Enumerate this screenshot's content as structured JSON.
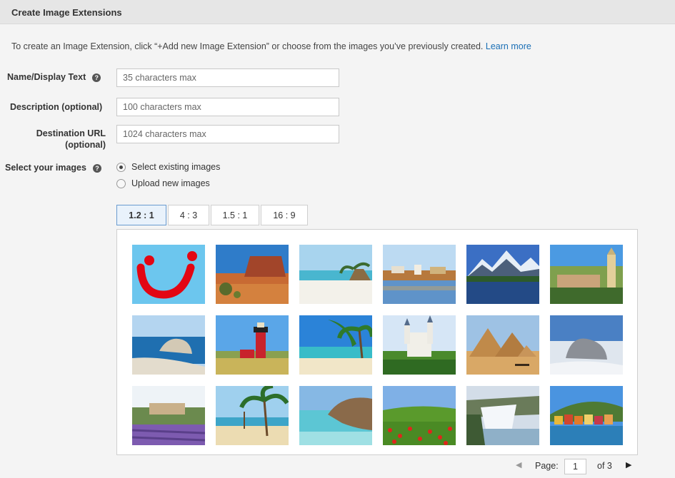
{
  "header": {
    "title": "Create Image Extensions"
  },
  "intro": {
    "text": "To create an Image Extension, click “+Add new Image Extension” or choose from the images you’ve previously created.",
    "link": "Learn more"
  },
  "form": {
    "name_label": "Name/Display Text",
    "name_placeholder": "35 characters max",
    "description_label": "Description (optional)",
    "description_placeholder": "100 characters max",
    "url_label_line1": "Destination URL",
    "url_label_line2": "(optional)",
    "url_placeholder": "1024 characters max",
    "images_label": "Select your images"
  },
  "image_source": {
    "options": [
      "Select existing images",
      "Upload new images"
    ],
    "selected": "Select existing images"
  },
  "ratio_tabs": {
    "items": [
      "1.2 : 1",
      "4 : 3",
      "1.5 : 1",
      "16 : 9"
    ],
    "active": "1.2 : 1"
  },
  "gallery": {
    "images": [
      "tui-logo",
      "desert-mesa",
      "beach-palm-hut",
      "lakeside-town",
      "mountain-lake",
      "church-tower-town",
      "rocky-coast",
      "red-lighthouse",
      "tropical-beach-palms",
      "castle-forest",
      "pyramids-camels",
      "snow-sculpture-beach",
      "lavender-village",
      "palm-beach",
      "rocky-cove-sea",
      "poppy-field",
      "waterfall",
      "colorful-harbor"
    ]
  },
  "pager": {
    "label": "Page:",
    "current": "1",
    "total_text": "of 3"
  },
  "colors": {
    "link": "#1a6fb5",
    "tab_active_bg": "#e9f2fb",
    "tab_active_border": "#6a9bd0",
    "tui_red": "#e30613",
    "tui_blue": "#6cc6ee"
  }
}
